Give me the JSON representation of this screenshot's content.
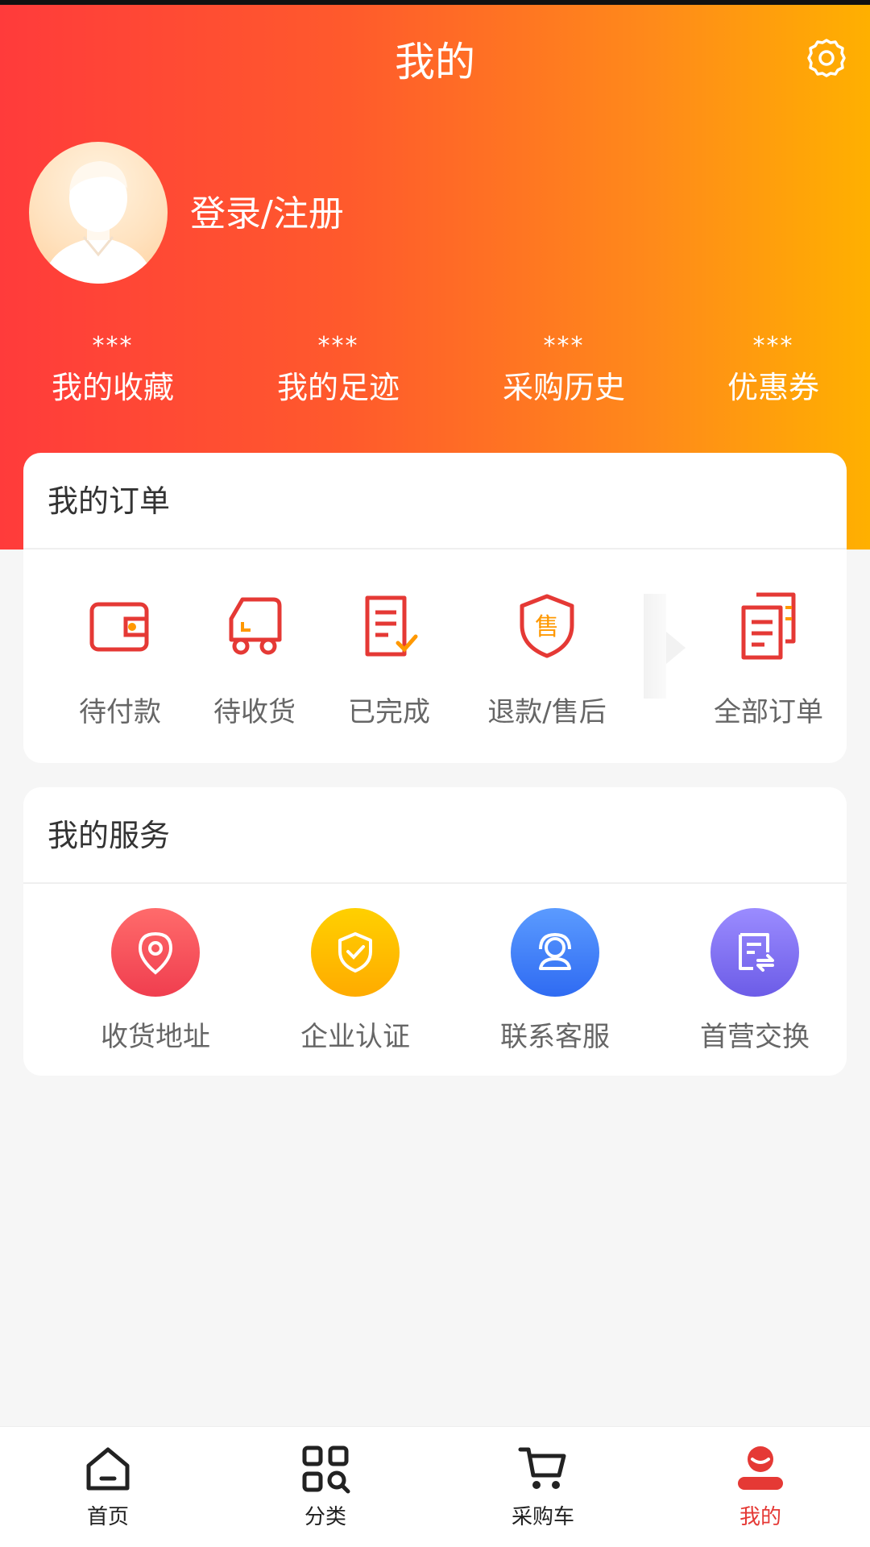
{
  "header": {
    "title": "我的",
    "login_label": "登录/注册"
  },
  "stats": [
    {
      "value": "***",
      "label": "我的收藏"
    },
    {
      "value": "***",
      "label": "我的足迹"
    },
    {
      "value": "***",
      "label": "采购历史"
    },
    {
      "value": "***",
      "label": "优惠券"
    }
  ],
  "orders": {
    "title": "我的订单",
    "items": [
      {
        "label": "待付款",
        "icon": "wallet-icon"
      },
      {
        "label": "待收货",
        "icon": "truck-icon"
      },
      {
        "label": "已完成",
        "icon": "completed-document-icon"
      },
      {
        "label": "退款/售后",
        "icon": "after-sales-shield-icon"
      },
      {
        "label": "全部订单",
        "icon": "all-orders-icon"
      }
    ]
  },
  "services": {
    "title": "我的服务",
    "items": [
      {
        "label": "收货地址",
        "icon": "location-pin-icon"
      },
      {
        "label": "企业认证",
        "icon": "shield-check-icon"
      },
      {
        "label": "联系客服",
        "icon": "customer-service-icon"
      },
      {
        "label": "首营交换",
        "icon": "exchange-document-icon"
      }
    ]
  },
  "tabbar": [
    {
      "label": "首页",
      "icon": "home-icon"
    },
    {
      "label": "分类",
      "icon": "category-icon"
    },
    {
      "label": "采购车",
      "icon": "cart-icon"
    },
    {
      "label": "我的",
      "icon": "profile-icon",
      "active": true
    }
  ],
  "colors": {
    "accent": "#e53935",
    "gradient_start": "#ff3b3b",
    "gradient_end": "#ffb000"
  }
}
